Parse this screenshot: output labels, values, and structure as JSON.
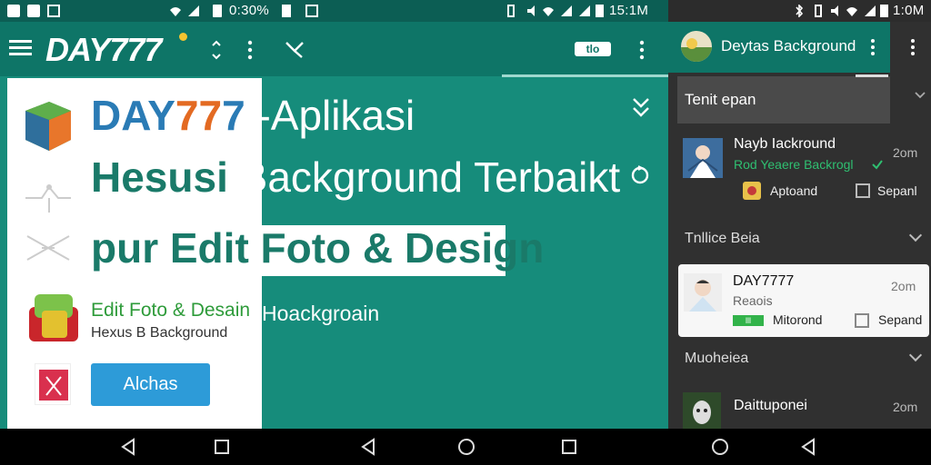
{
  "statusbar": {
    "time_left": "0:30%",
    "time_mid": "15:1M",
    "time_right": "1:0M"
  },
  "appbar": {
    "brand": "DAY777",
    "chip_label": "tlo"
  },
  "hero": {
    "line1_a": "DAY",
    "line1_b": "77",
    "line1_c": "7",
    "line1_d": " -Aplikasi",
    "line2_a": "Hesusi ",
    "line2_b": "Background Terbaikt",
    "line3": "pur Edit Foto & Design"
  },
  "feature": {
    "title": "Edit Foto & Desain",
    "subtitle": "Hexus B Background",
    "right_text": "Hoackgroain",
    "button_label": "Alchas"
  },
  "panel": {
    "title": "Deytas Background",
    "dropdown_label": "Tenit epan",
    "notif1": {
      "title": "Nayb Iackround",
      "subtitle": "Rod Yeaere Backrogl",
      "time": "2om",
      "action1": "Aptoand",
      "action2": "Sepanl"
    },
    "section1": "Tnllice Beia",
    "notif2": {
      "title": "DAY7777",
      "subtitle": "Reaois",
      "time": "2om",
      "action1": "Mitorond",
      "action2": "Sepand",
      "badge": "lll"
    },
    "section2": "Muoheiea",
    "notif3": {
      "title": "Daittuponei",
      "time": "2om"
    }
  },
  "colors": {
    "brand_green": "#168c7b",
    "appbar": "#0e7567",
    "headline": "#1a7a69",
    "button_blue": "#2d9bd8",
    "panel_dark": "#303030"
  }
}
